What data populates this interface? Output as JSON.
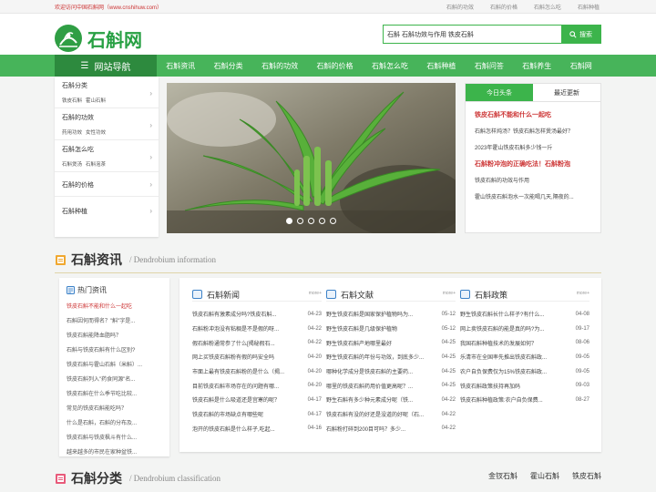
{
  "topbar": {
    "welcome": "欢迎访问中国石斛网（www.cnshihuw.com）",
    "links": [
      "石斛的功效",
      "石斛的价格",
      "石斛怎么吃",
      "石斛种植"
    ]
  },
  "header": {
    "logo_text": "石斛网",
    "search_value": "石斛 石斛功效与作用 铁皮石斛",
    "search_btn": "搜索"
  },
  "nav": {
    "title": "网站导航",
    "items": [
      "石斛资讯",
      "石斛分类",
      "石斛的功效",
      "石斛的价格",
      "石斛怎么吃",
      "石斛种植",
      "石斛问答",
      "石斛养生",
      "石斛网"
    ]
  },
  "sidebar": [
    {
      "title": "石斛分类",
      "subs": [
        "铁皮石斛",
        "霍山石斛"
      ]
    },
    {
      "title": "石斛的功效",
      "subs": [
        "药用功效",
        "女性功效"
      ]
    },
    {
      "title": "石斛怎么吃",
      "subs": [
        "石斛煲汤",
        "石斛泡茶"
      ]
    },
    {
      "title": "石斛的价格",
      "subs": []
    },
    {
      "title": "石斛种植",
      "subs": []
    }
  ],
  "news_panel": {
    "tabs": [
      "今日头条",
      "最近更新"
    ],
    "headline1": "铁皮石斛不能和什么一起吃",
    "lines1": [
      "石斛怎样炖汤？铁皮石斛怎样煲汤最好？",
      "2023年霍山铁皮石斛多少钱一斤"
    ],
    "headline2": "石斛粉冲泡的正确吃法！石斛粉泡",
    "lines2": [
      "铁皮石斛的功效与作用",
      "霍山铁皮石斛泡水一次能喝几天,隔夜的..."
    ]
  },
  "section1": {
    "title": "石斛资讯",
    "en": "/ Dendrobium information"
  },
  "hot": {
    "title": "热门资讯",
    "items": [
      "铁皮石斛不能和什么一起吃",
      "石斛因何而得名？\"斛\"字是...",
      "铁皮石斛能降血脂吗？",
      "石斛与铁皮石斛有什么区别?",
      "铁皮石斛与霍山石斛（米斛）...",
      "铁皮石斛列入\"药食同源\"名...",
      "铁皮石斛在什么季节吃比较...",
      "常见的铁皮石斛能吃吗？",
      "什么是石斛，石斛的分布及...",
      "铁皮石斛与铁皮枫斗有什么...",
      "越来越多的市民在家种盆铁..."
    ]
  },
  "columns": [
    {
      "title": "石斛新闻",
      "more": "more+",
      "rows": [
        [
          "铁皮石斛有激素成分吗?铁皮石斛...",
          "04-23"
        ],
        [
          "石斛粉冲泡没有粘稠是不是假的呀...",
          "04-22"
        ],
        [
          "假石斛粉通常参了什么[揭秘假石...",
          "04-22"
        ],
        [
          "网上买铁皮石斛粉有假的吗安全吗",
          "04-20"
        ],
        [
          "市面上最有铁皮石斛粉的是什么（揭...",
          "04-20"
        ],
        [
          "目前铁皮石斛市场存在的问题有哪...",
          "04-20"
        ],
        [
          "铁皮石斛是什么吸道还是宫寒的呢？",
          "04-17"
        ],
        [
          "铁皮石斛的市场缺点有哪些呢",
          "04-17"
        ],
        [
          "泡开的铁皮石斛是什么样子,吃起...",
          "04-16"
        ]
      ]
    },
    {
      "title": "石斛文献",
      "more": "more+",
      "rows": [
        [
          "野生铁皮石斛是国家保护植物吗为...",
          "05-12"
        ],
        [
          "野生铁皮石斛是几级保护植物",
          "05-12"
        ],
        [
          "野生铁皮石斛产地哪里最好",
          "04-25"
        ],
        [
          "野生铁皮石斛的年份与功效，到底多少...",
          "04-25"
        ],
        [
          "哪种化学成分是铁皮石斛的主要药...",
          "04-25"
        ],
        [
          "哪里的铁皮石斛药用价值更高呢？...",
          "04-25"
        ],
        [
          "野生石斛有多少种元素成分呢（铁...",
          "04-22"
        ],
        [
          "铁皮石斛有没的好还是没道的好呢（石...",
          "04-22"
        ],
        [
          "石斛粉打碎到200目可吗？多少...",
          "04-22"
        ]
      ]
    },
    {
      "title": "石斛政策",
      "more": "more+",
      "rows": [
        [
          "野生铁皮石斛长什么样子?有什么...",
          "04-08"
        ],
        [
          "网上卖铁皮石斛的能是真的吗?为...",
          "09-17"
        ],
        [
          "我国石斛种植技术的发展如何？",
          "08-06"
        ],
        [
          "乐清市在全国率先推出铁皮石斛政...",
          "09-05"
        ],
        [
          "农户自负保费仅为15%铁皮石斛政...",
          "09-05"
        ],
        [
          "铁皮石斛政策扶持再加码",
          "09-03"
        ],
        [
          "铁皮石斛种植政策:农户自负保费...",
          "08-27"
        ]
      ]
    }
  ],
  "section2": {
    "title": "石斛分类",
    "en": "/ Dendrobium classification",
    "tabs": [
      "金钗石斛",
      "霍山石斛",
      "铁皮石斛"
    ]
  },
  "colors": {
    "green": "#3cb44b",
    "dark_green": "#2d8a3e",
    "red": "#c33"
  }
}
